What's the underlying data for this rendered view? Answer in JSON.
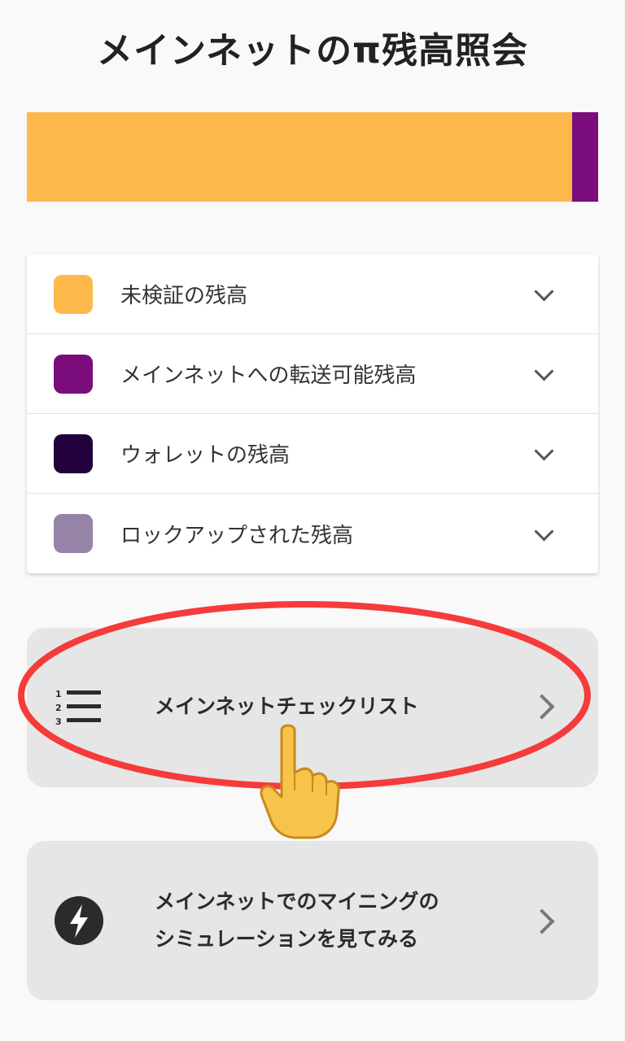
{
  "page": {
    "title": "メインネットのπ残高照会"
  },
  "balance_bar": {
    "segments": [
      {
        "name": "未検証の残高",
        "fraction": 0.955,
        "color": "#fdb84c"
      },
      {
        "name": "メインネットへの転送可能残高",
        "fraction": 0.045,
        "color": "#7b0c7b"
      }
    ]
  },
  "legend": {
    "items": [
      {
        "label": "未検証の残高",
        "color": "#fdb84c"
      },
      {
        "label": "メインネットへの転送可能残高",
        "color": "#7b0c7b"
      },
      {
        "label": "ウォレットの残高",
        "color": "#22003c"
      },
      {
        "label": "ロックアップされた残高",
        "color": "#9583a8"
      }
    ]
  },
  "cards": {
    "checklist": {
      "label": "メインネットチェックリスト",
      "icon": "numbered-list-icon"
    },
    "simulation": {
      "line1": "メインネットでのマイニングの",
      "line2": "シミュレーションを見てみる",
      "icon": "lightning-bolt-icon"
    }
  },
  "annotations": {
    "ring_color": "#f53b3b",
    "pointer": "pointing-hand-emoji"
  }
}
